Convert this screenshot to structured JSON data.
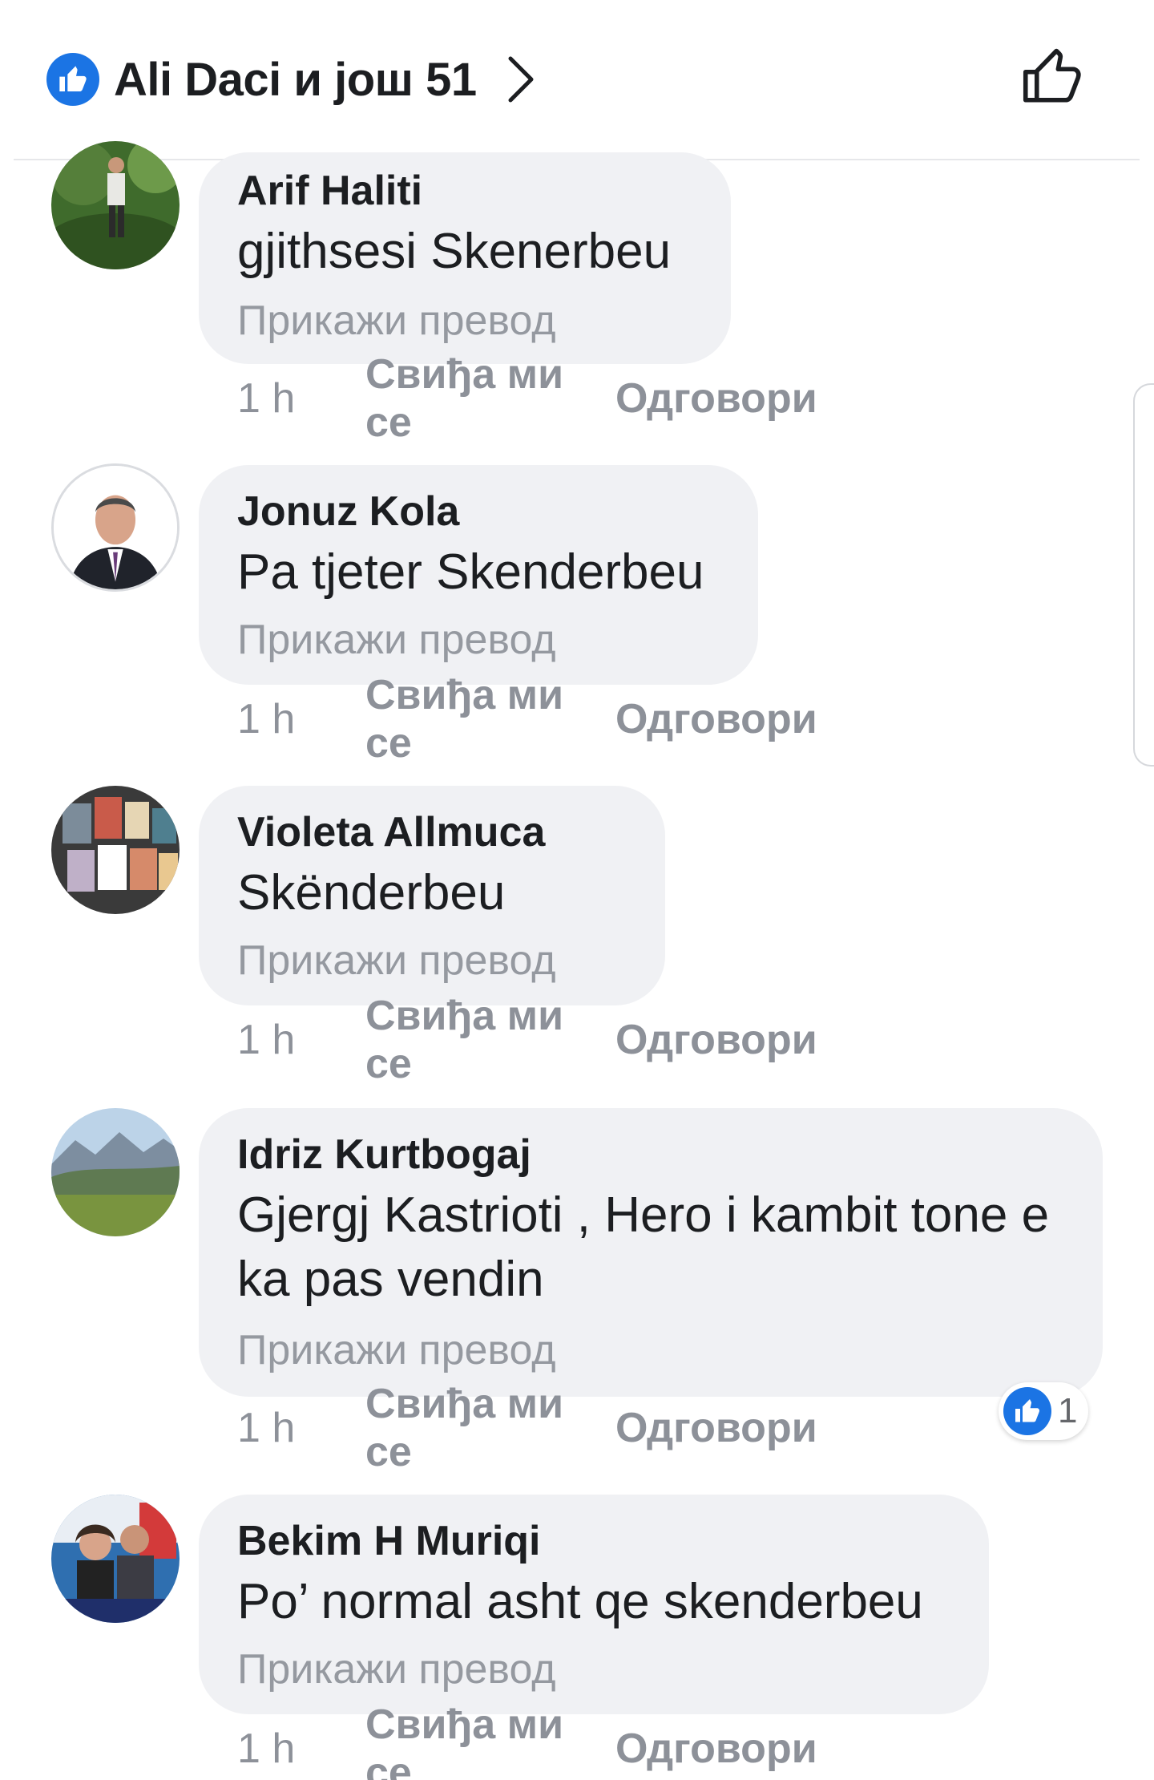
{
  "header": {
    "reaction_summary": "Ali Daci и још 51",
    "icons": {
      "reaction": "like-icon",
      "chevron": "chevron-right-icon",
      "like_button": "thumbs-up-outline-icon"
    }
  },
  "colors": {
    "accent": "#1b74e4",
    "bubble": "#f0f1f4",
    "text": "#1c1e21",
    "muted": "#8d9199"
  },
  "comments": [
    {
      "author": "Arif Haliti",
      "text": "gjithsesi Skenerbeu",
      "translate": "Прикажи превод",
      "time": "1 h",
      "like": "Свиђа ми се",
      "reply": "Одговори"
    },
    {
      "author": "Jonuz Kola",
      "text": "Pa tjeter Skenderbeu",
      "translate": "Прикажи превод",
      "time": "1 h",
      "like": "Свиђа ми се",
      "reply": "Одговори"
    },
    {
      "author": "Violeta Allmuca",
      "text": "Skënderbeu",
      "translate": "Прикажи превод",
      "time": "1 h",
      "like": "Свиђа ми се",
      "reply": "Одговори"
    },
    {
      "author": "Idriz Kurtbogaj",
      "text": "Gjergj Kastrioti , Hero i kambit tone e ka pas vendin",
      "translate": "Прикажи превод",
      "time": "1 h",
      "like": "Свиђа ми се",
      "reply": "Одговори",
      "reaction_count": "1"
    },
    {
      "author": "Bekim H Muriqi",
      "text": "Po’ normal asht qe skenderbeu",
      "translate": "Прикажи превод",
      "time": "1 h",
      "like": "Свиђа ми се",
      "reply": "Одговори"
    }
  ]
}
